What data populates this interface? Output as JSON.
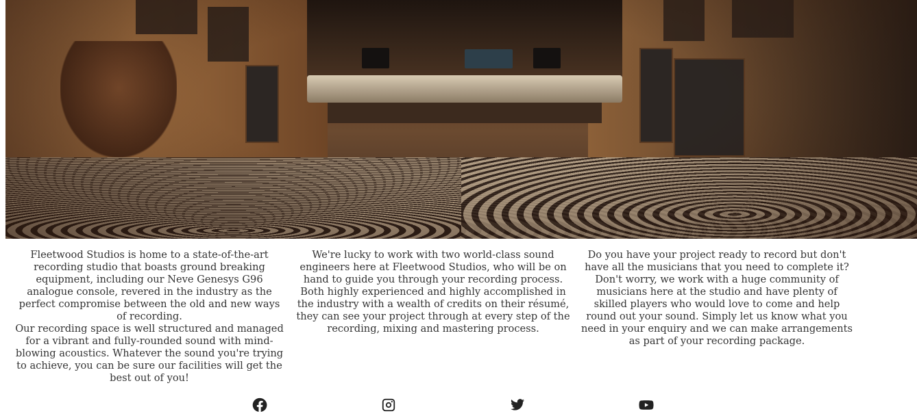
{
  "hero": {
    "icon": "studio-photo"
  },
  "columns": [
    {
      "paragraphs": [
        "Fleetwood Studios is home to a state-of-the-art recording studio that boasts ground breaking equipment, including our Neve Genesys G96 analogue console, revered in the industry as the perfect compromise between the old and new ways of recording.",
        "Our recording space is well structured and managed for a vibrant and fully-rounded sound with mind-blowing acoustics. Whatever the sound you're trying to achieve, you can be sure our facilities will get the best out of you!"
      ]
    },
    {
      "paragraphs": [
        "We're lucky to work with two world-class sound engineers here at Fleetwood Studios, who will be on hand to guide you through your recording process. Both highly experienced and highly accomplished in the industry with a wealth of credits on their résumé, they can see your project through at every step of the recording, mixing and mastering process."
      ]
    },
    {
      "paragraphs": [
        "Do you have your project ready to record but don't have all the musicians that you need to complete it? Don't worry, we work with a huge community of musicians here at the studio and have plenty of skilled players who would love to come and help round out your sound. Simply let us know what you need in your enquiry and we can make arrangements as part of your recording package."
      ]
    }
  ],
  "social": [
    {
      "icon": "facebook-icon"
    },
    {
      "icon": "instagram-icon"
    },
    {
      "icon": "twitter-icon"
    },
    {
      "icon": "youtube-icon"
    }
  ]
}
